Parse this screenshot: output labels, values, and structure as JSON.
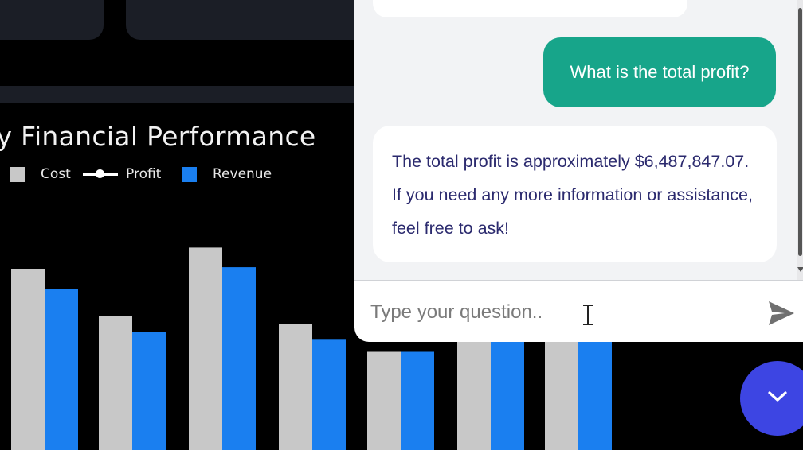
{
  "chart": {
    "title": "ly Financial Performance",
    "legend": [
      {
        "label": "Cost",
        "color": "#c8c8c8",
        "kind": "swatch"
      },
      {
        "label": "Profit",
        "color": "#ffffff",
        "kind": "line"
      },
      {
        "label": "Revenue",
        "color": "#1a7ff0",
        "kind": "swatch"
      }
    ]
  },
  "chart_data": {
    "type": "bar",
    "title": "ly Financial Performance",
    "series": [
      {
        "name": "Cost",
        "color": "#c8c8c8",
        "values": [
          240,
          177,
          268,
          167,
          130,
          150,
          160
        ]
      },
      {
        "name": "Revenue",
        "color": "#1a7ff0",
        "values": [
          213,
          156,
          242,
          146,
          130,
          150,
          160
        ]
      }
    ],
    "ylim": [
      0,
      300
    ]
  },
  "chat": {
    "messages": [
      {
        "role": "bot",
        "text": ""
      },
      {
        "role": "user",
        "text": "What is the total profit?"
      },
      {
        "role": "bot",
        "text": "The total profit is approximately $6,487,847.07. If you need any more information or assistance, feel free to ask!"
      }
    ],
    "input": {
      "placeholder": "Type your question..",
      "value": ""
    },
    "send_icon": "send-icon"
  },
  "toggle": {
    "icon": "chevron-down-icon",
    "color": "#3d45e3"
  }
}
